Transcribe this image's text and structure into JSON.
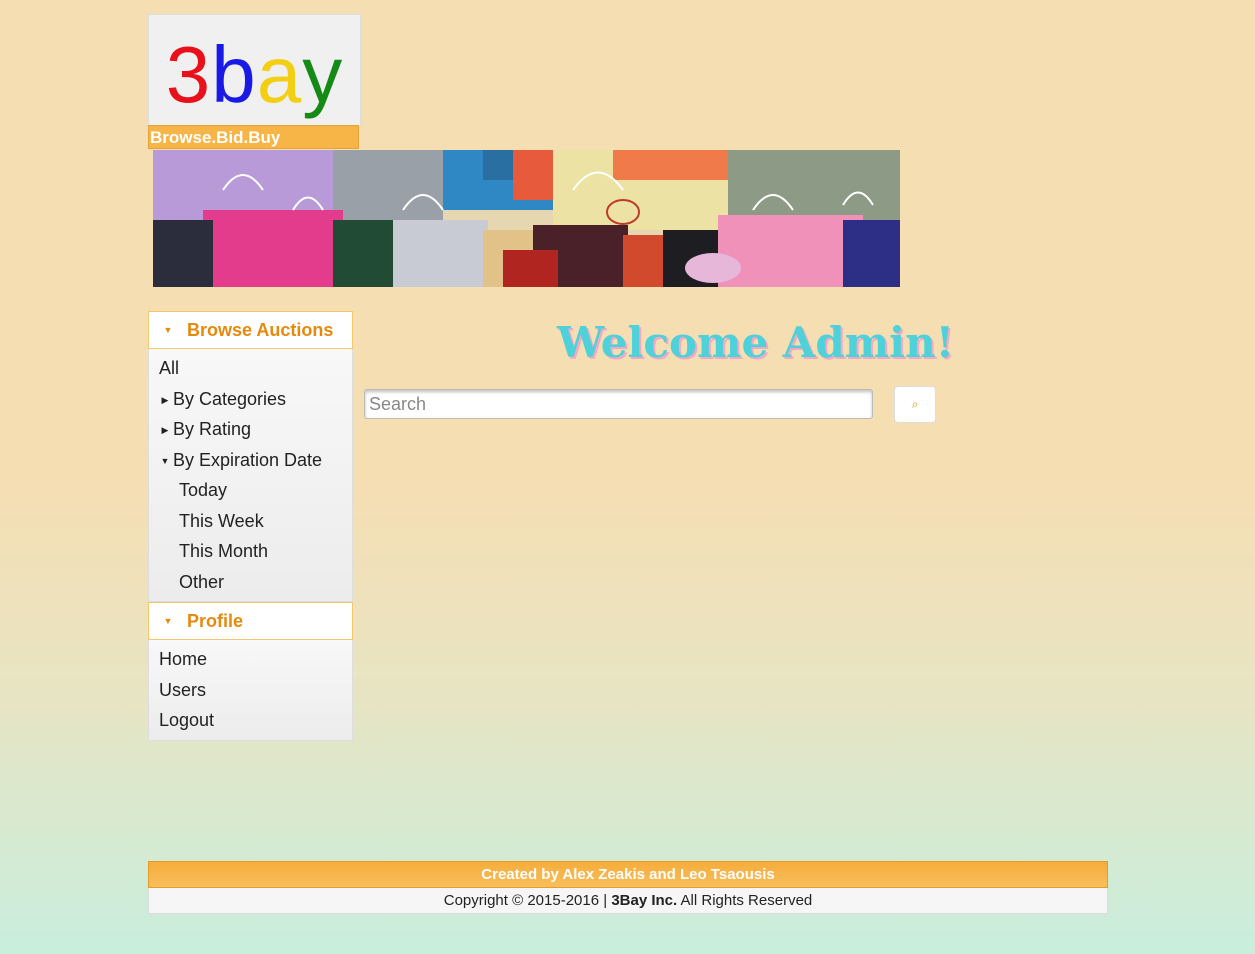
{
  "logo": {
    "letters": [
      "3",
      "b",
      "a",
      "y"
    ],
    "colors": [
      "#e8101a",
      "#1a1ae6",
      "#f2cf12",
      "#168a16"
    ],
    "tagline": "Browse.Bid.Buy"
  },
  "banner": {
    "icon": "shopping-bags-image"
  },
  "sidebar": {
    "browse": {
      "title": "Browse Auctions",
      "all": "All",
      "by_categories": "By Categories",
      "by_rating": "By Rating",
      "by_expiration": "By Expiration Date",
      "expiration_items": [
        "Today",
        "This Week",
        "This Month",
        "Other"
      ]
    },
    "profile": {
      "title": "Profile",
      "items": [
        "Home",
        "Users",
        "Logout"
      ]
    }
  },
  "main": {
    "welcome": "Welcome Admin!",
    "search_placeholder": "Search",
    "search_value": "",
    "search_button_icon": "search-icon"
  },
  "footer": {
    "credit": "Created by Alex Zeakis and Leo Tsaousis",
    "copyright_prefix": "Copyright © 2015-2016 |",
    "company": "3Bay Inc.",
    "copyright_suffix": "All Rights Reserved"
  },
  "colors": {
    "accent": "#e58a0c",
    "footer_bar": "#f6ad3c",
    "welcome": "#4fd1d9",
    "welcome_shadow": "#f4a8c4"
  }
}
